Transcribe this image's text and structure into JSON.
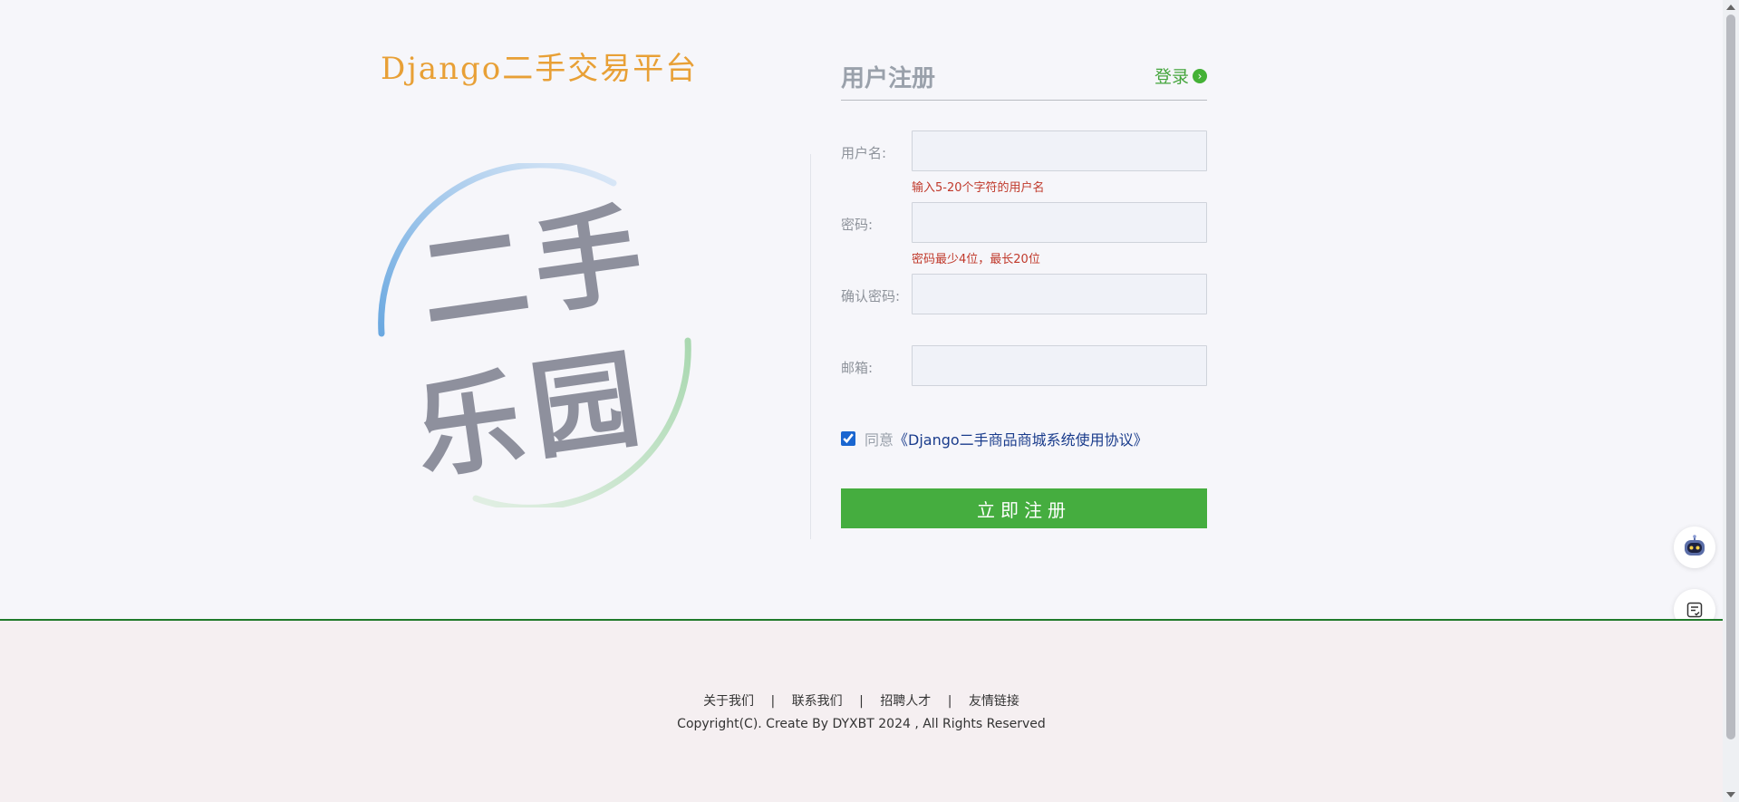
{
  "brand": {
    "title": "Django二手交易平台",
    "logo_text": [
      "二",
      "手",
      "乐",
      "园"
    ]
  },
  "form": {
    "title": "用户注册",
    "login_link": "登录",
    "fields": [
      {
        "label": "用户名:",
        "value": "",
        "hint": "输入5-20个字符的用户名"
      },
      {
        "label": "密码:",
        "value": "",
        "hint": "密码最少4位，最长20位"
      },
      {
        "label": "确认密码:",
        "value": "",
        "hint": ""
      },
      {
        "label": "邮箱:",
        "value": "",
        "hint": ""
      }
    ],
    "agree_prefix": "同意",
    "agree_link": "《Django二手商品商城系统使用协议》",
    "agree_checked": true,
    "submit_label": "立即注册"
  },
  "footer": {
    "links": [
      "关于我们",
      "联系我们",
      "招聘人才",
      "友情链接"
    ],
    "separator": "|",
    "copyright": "Copyright(C). Create By DYXBT 2024 , All Rights Reserved"
  },
  "colors": {
    "brand_title": "#e8a036",
    "accent_green": "#45ad3f",
    "hint_red": "#c0392b",
    "link_blue": "#1a3c8c",
    "logo_gray": "#8e909d"
  },
  "icons": {
    "float_top": "robot-assistant-icon",
    "float_bottom": "checklist-icon"
  }
}
